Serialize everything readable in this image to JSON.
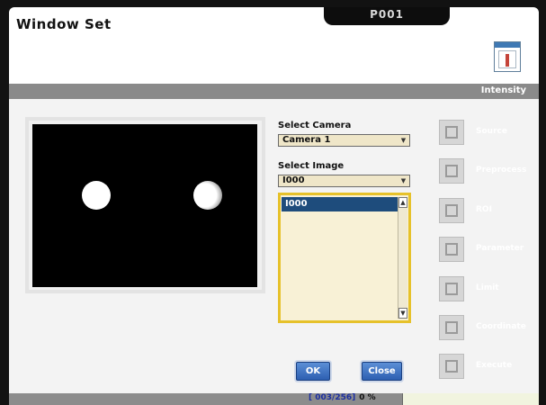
{
  "window": {
    "title": "Window Set",
    "program": "P001"
  },
  "section": {
    "label": "Intensity"
  },
  "camera": {
    "label": "Select Camera",
    "selected": "Camera 1"
  },
  "image": {
    "label": "Select Image",
    "selected": "I000",
    "list": [
      "I000"
    ]
  },
  "buttons": {
    "ok": "OK",
    "close": "Close"
  },
  "nav": {
    "items": [
      {
        "label": "Source",
        "icon": "source-icon"
      },
      {
        "label": "Preprocess",
        "icon": "preprocess-icon"
      },
      {
        "label": "ROI",
        "icon": "roi-icon"
      },
      {
        "label": "Parameter",
        "icon": "parameter-icon"
      },
      {
        "label": "Limit",
        "icon": "limit-icon"
      },
      {
        "label": "Coordinate",
        "icon": "coordinate-icon"
      },
      {
        "label": "Execute",
        "icon": "execute-icon"
      }
    ]
  },
  "status": {
    "counter": "[ 003/256]",
    "percent": "0 %"
  },
  "colors": {
    "accent": "#e6c12a",
    "button": "#2d5fb1",
    "selection": "#1e4c7c",
    "counter": "#1c2fa0"
  }
}
